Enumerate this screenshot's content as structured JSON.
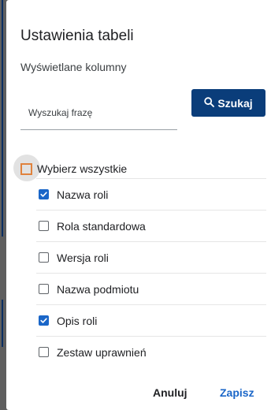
{
  "dialog": {
    "title": "Ustawienia tabeli",
    "subtitle": "Wyświetlane kolumny"
  },
  "search": {
    "value": "",
    "placeholder": "Wyszukaj frazę",
    "button_label": "Szukaj",
    "button_icon": "search-icon"
  },
  "select_all": {
    "label": "Wybierz wszystkie",
    "checked": false,
    "accent_color": "#e0823d"
  },
  "columns": [
    {
      "label": "Nazwa roli",
      "checked": true
    },
    {
      "label": "Rola standardowa",
      "checked": false
    },
    {
      "label": "Wersja roli",
      "checked": false
    },
    {
      "label": "Nazwa podmiotu",
      "checked": false
    },
    {
      "label": "Opis roli",
      "checked": true
    },
    {
      "label": "Zestaw uprawnień",
      "checked": false
    }
  ],
  "footer": {
    "cancel_label": "Anuluj",
    "save_label": "Zapisz"
  },
  "colors": {
    "primary": "#0a3d7a",
    "link": "#1a66c8",
    "checkbox_checked": "#1a66c8"
  }
}
